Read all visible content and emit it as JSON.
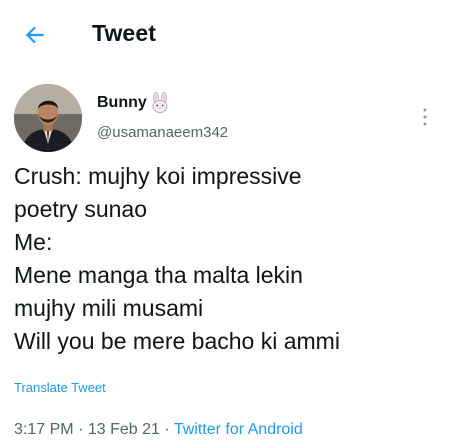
{
  "header": {
    "title": "Tweet",
    "back_icon": "arrow-left-icon",
    "accent_color": "#1d9bf0"
  },
  "author": {
    "name": "Bunny",
    "emoji_icon": "rabbit-face-icon",
    "handle": "@usamanaeem342"
  },
  "tweet": {
    "lines": [
      "Crush: mujhy koi impressive",
      "poetry sunao",
      "Me:",
      "Mene manga tha malta lekin",
      "mujhy mili musami",
      "Will you be mere bacho ki ammi"
    ],
    "translate_label": "Translate Tweet"
  },
  "meta": {
    "time": "3:17 PM",
    "separator": "·",
    "date": "13 Feb 21",
    "source": "Twitter for Android"
  }
}
